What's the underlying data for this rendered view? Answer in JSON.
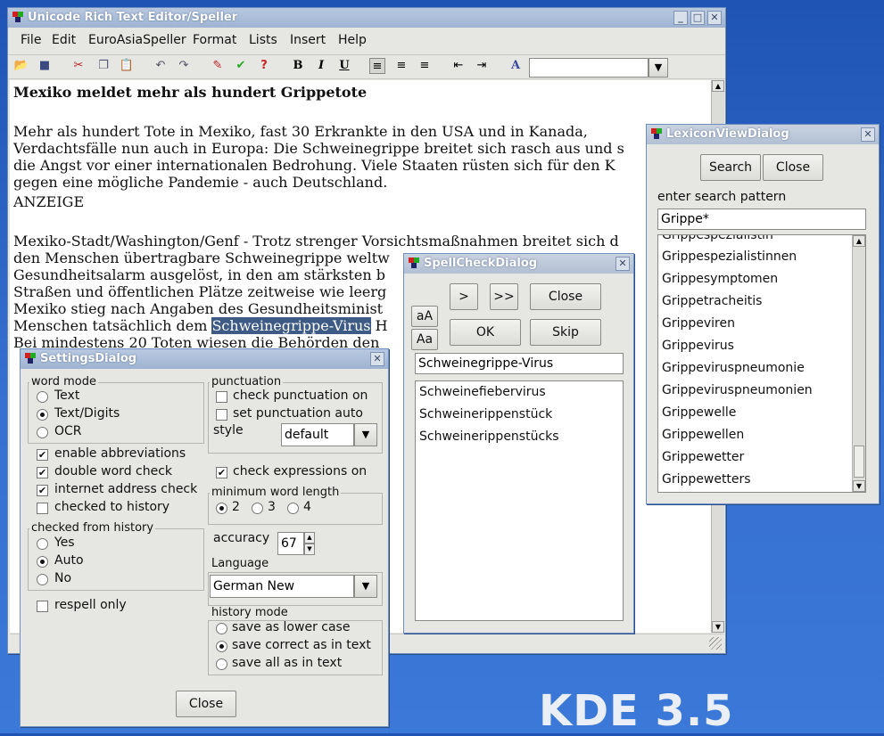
{
  "main": {
    "title": "Unicode Rich Text Editor/Speller",
    "menu": [
      "File",
      "Edit",
      "EuroAsiaSpeller",
      "Format",
      "Lists",
      "Insert",
      "Help"
    ],
    "toolbar": {
      "bold": "B",
      "italic": "I",
      "underline": "U",
      "font_combo_value": ""
    },
    "doc": {
      "heading": "Mexiko meldet mehr als hundert Grippetote",
      "lines": [
        "Mehr als hundert Tote in Mexiko, fast 30 Erkrankte in den USA und in Kanada,",
        "Verdachtsfälle nun auch in Europa: Die Schweinegrippe breitet sich rasch aus und s",
        "die Angst vor einer internationalen Bedrohung. Viele Staaten rüsten sich für den K",
        "gegen eine mögliche Pandemie - auch Deutschland.",
        "ANZEIGE",
        "",
        "Mexiko-Stadt/Washington/Genf - Trotz strenger Vorsichtsmaßnahmen breitet sich d",
        "den Menschen übertragbare Schweinegrippe weltw",
        "Gesundheitsalarm ausgelöst, in den am stärksten b",
        "Straßen und öffentlichen Plätze zeitweise wie leerg",
        "Mexiko stieg nach Angaben des Gesundheitsminist"
      ],
      "line_sel_before": "Menschen tatsächlich dem ",
      "line_sel_word": "Schweinegrippe-Virus",
      "line_sel_after": " H",
      "line_partial": "Bei mindestens 20 Toten wiesen die Behörden den"
    }
  },
  "lexicon": {
    "title": "LexiconViewDialog",
    "search_label": "Search",
    "close_label": "Close",
    "pattern_label": "enter search pattern",
    "pattern_value": "Grippe*",
    "items": [
      "Grippespezialistin",
      "Grippespezialistinnen",
      "Grippesymptomen",
      "Grippetracheitis",
      "Grippeviren",
      "Grippevirus",
      "Grippeviruspneumonie",
      "Grippeviruspneumonien",
      "Grippewelle",
      "Grippewellen",
      "Grippewetter",
      "Grippewetters"
    ]
  },
  "spell": {
    "title": "SpellCheckDialog",
    "next_label": ">",
    "next_all_label": ">>",
    "close_label": "Close",
    "lower_label": "aA",
    "upper_label": "Aa",
    "ok_label": "OK",
    "skip_label": "Skip",
    "word_value": "Schweinegrippe-Virus",
    "suggestions": [
      "Schweinefiebervirus",
      "Schweinerippenstück",
      "Schweinerippenstücks"
    ]
  },
  "settings": {
    "title": "SettingsDialog",
    "word_mode": {
      "title": "word mode",
      "options": [
        "Text",
        "Text/Digits",
        "OCR"
      ],
      "selected": 1
    },
    "punctuation": {
      "title": "punctuation",
      "check_label": "check punctuation on",
      "auto_label": "set punctuation auto",
      "style_label": "style",
      "style_value": "default"
    },
    "checks": [
      {
        "label": "enable abbreviations",
        "checked": true
      },
      {
        "label": "double word check",
        "checked": true
      },
      {
        "label": "internet address check",
        "checked": true
      },
      {
        "label": "checked to history",
        "checked": false
      }
    ],
    "expressions_label": "check expressions on",
    "min_word": {
      "title": "minimum word length",
      "options": [
        "2",
        "3",
        "4"
      ],
      "selected": 0
    },
    "history_from": {
      "title": "checked from history",
      "options": [
        "Yes",
        "Auto",
        "No"
      ],
      "selected": 1
    },
    "accuracy_label": "accuracy",
    "accuracy_value": "67",
    "language_label": "Language",
    "language_value": "German New",
    "respell_label": "respell only",
    "history_mode": {
      "title": "history mode",
      "options": [
        "save as lower case",
        "save correct as in text",
        "save all as in text"
      ],
      "selected": 1
    },
    "close_label": "Close"
  },
  "desktop": {
    "brand": "KDE 3.5"
  },
  "colors": {
    "selection": "#3d5b85",
    "titlebar": "#a9bcd8",
    "desktop": "#2f68c8"
  }
}
